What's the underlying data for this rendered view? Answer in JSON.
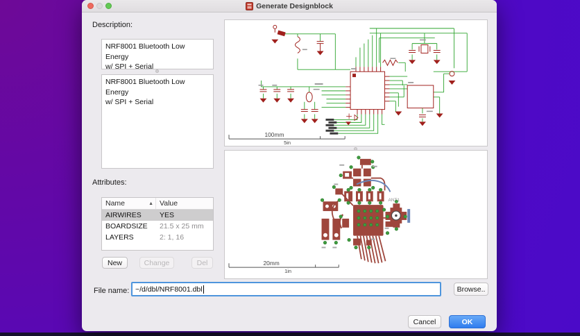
{
  "window": {
    "title": "Generate Designblock"
  },
  "description": {
    "label": "Description:",
    "summary": "NRF8001 Bluetooth Low Energy\nw/ SPI + Serial",
    "detail": "NRF8001 Bluetooth Low Energy\nw/ SPI + Serial"
  },
  "attributes": {
    "label": "Attributes:",
    "columns": {
      "name": "Name",
      "value": "Value"
    },
    "sort_icon": "▲",
    "rows": [
      {
        "name": "AIRWIRES",
        "value": "YES"
      },
      {
        "name": "BOARDSIZE",
        "value": "21.5 x 25 mm"
      },
      {
        "name": "LAYERS",
        "value": "2: 1, 16"
      }
    ],
    "selected_row": "AIRWIRES",
    "buttons": {
      "new": "New",
      "change": "Change",
      "del": "Del"
    }
  },
  "previews": {
    "schematic": {
      "scale_metric": "100mm",
      "scale_imperial": "5in"
    },
    "board": {
      "scale_metric": "20mm",
      "scale_imperial": "1in",
      "antenna_label": "ANT1"
    }
  },
  "file": {
    "label": "File name:",
    "value": "~/d/dbl/NRF8001.dbl",
    "browse": "Browse.."
  },
  "actions": {
    "cancel": "Cancel",
    "ok": "OK"
  },
  "colors": {
    "desktop_gradient_start": "#6e0997",
    "desktop_gradient_end": "#4e09c6",
    "accent_blue": "#3c82f0",
    "selection_gray": "#cecdce",
    "schematic_wire_green": "#2ba32b",
    "schematic_part_red": "#a0201c",
    "copper_red": "#9e463c",
    "via_green": "#3f9b3f",
    "bottom_trace_blue": "#6b86b8"
  }
}
